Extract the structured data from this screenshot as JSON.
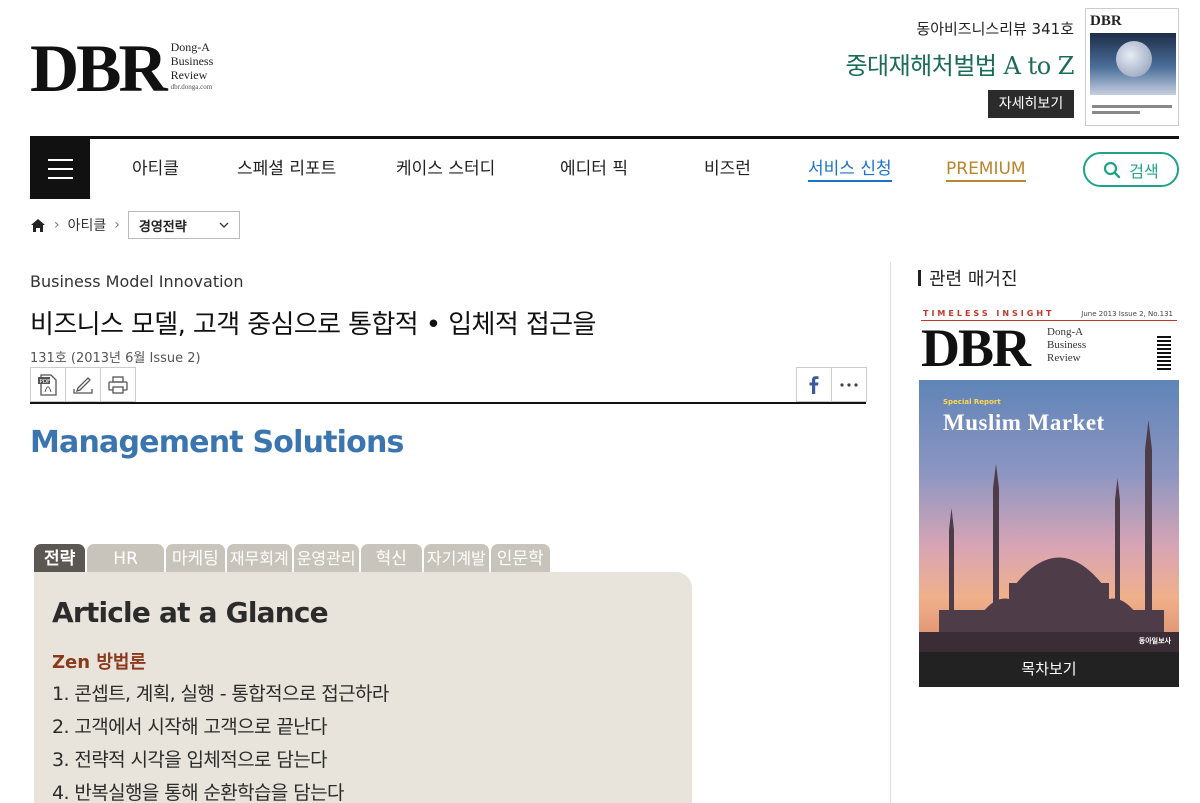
{
  "header": {
    "logo_text": "DBR",
    "logo_sub": [
      "Dong-A",
      "Business",
      "Review"
    ],
    "logo_url": "dbr.donga.com",
    "issue_label": "동아비즈니스리뷰 341호",
    "issue_headline": "중대재해처벌법 A to Z",
    "detail_button": "자세히보기",
    "cover_thumb_logo": "DBR"
  },
  "nav": {
    "items": [
      "아티클",
      "스페셜 리포트",
      "케이스 스터디",
      "에디터 픽",
      "비즈런"
    ],
    "service_label": "서비스 신청",
    "premium_label": "PREMIUM",
    "search_label": "검색",
    "colors": {
      "service": "#1a73c8",
      "premium": "#b8862b",
      "search": "#1ea28a"
    }
  },
  "breadcrumb": {
    "level1": "아티클",
    "selected": "경영전략"
  },
  "article": {
    "category": "Business Model Innovation",
    "title": "비즈니스 모델, 고객 중심으로 통합적 • 입체적 접근을",
    "meta": "131호 (2013년 6월 Issue 2)",
    "section_title": "Management Solutions",
    "tabs": [
      "전략",
      "HR",
      "마케팅",
      "재무회계",
      "운영관리",
      "혁신",
      "자기계발",
      "인문학"
    ],
    "glance_title": "Article at a Glance",
    "glance_subtitle": "Zen 방법론",
    "glance_points": [
      "1. 콘셉트, 계획, 실행 - 통합적으로 접근하라",
      "2. 고객에서 시작해 고객으로 끝난다",
      "3. 전략적 시각을 입체적으로 담는다",
      "4. 반복실행을 통해 순환학습을 담는다"
    ]
  },
  "sidebar": {
    "heading": "관련 매거진",
    "magazine": {
      "tagline": "TIMELESS INSIGHT",
      "issue": "June 2013 Issue 2, No.131",
      "logo": "DBR",
      "logo_sub": [
        "Dong-A",
        "Business",
        "Review"
      ],
      "special_report": "Special Report",
      "cover_headline": "Muslim Market",
      "publisher": "동아일보사",
      "toc_button": "목차보기"
    }
  }
}
